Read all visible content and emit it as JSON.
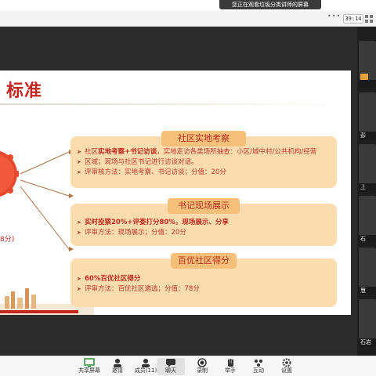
{
  "banner": {
    "text": "您正在观看垃圾分类讲师的屏幕"
  },
  "titlebar": {
    "more_glyph": "•••",
    "timer": "39:14"
  },
  "slide": {
    "title": "标准",
    "side_note": "8分)"
  },
  "cards": [
    {
      "header": "社区实地考察",
      "line1_a": "社区",
      "line1_bold": "实地考察+书记访谈",
      "line1_b": "，实地走访各类场所抽查：小区/城中村/公共机构/经营",
      "line1_c": "区域；现场与社区书记进行访谈对话。",
      "line2": "评审核方法：实地考察、书记访谈；分值：20分"
    },
    {
      "header": "书记现场展示",
      "line1": "实时投票20%+评委打分80%，现场展示、分享",
      "line2": "评审方法：现场展示；分值：20分"
    },
    {
      "header": "百优社区得分",
      "line1": "60%百优社区得分",
      "line2": "评审方法：百优社区遴选；分值：78分"
    }
  ],
  "participants": [
    "",
    "彭",
    "上",
    "石",
    "慧",
    "石岩"
  ],
  "toolbar": {
    "share": "共享屏幕",
    "invite": "邀请",
    "members": "成员(11)",
    "chat": "聊天",
    "record": "录制",
    "raise_hand": "举手",
    "interaction": "互动",
    "settings": "设置"
  }
}
